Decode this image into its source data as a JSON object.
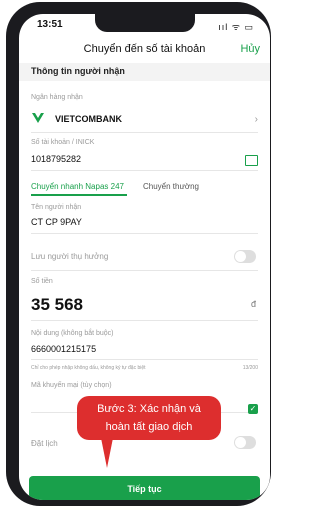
{
  "status": {
    "time": "13:51",
    "icons": "ııl ᯤ ▭"
  },
  "header": {
    "title": "Chuyển đến số tài khoản",
    "cancel": "Hủy"
  },
  "section_title": "Thông tin người nhận",
  "bank": {
    "label": "Ngân hàng nhận",
    "name": "VIETCOMBANK"
  },
  "account": {
    "label": "Số tài khoản / INICK",
    "value": "1018795282"
  },
  "tabs": {
    "active": "Chuyển nhanh Napas 247",
    "inactive": "Chuyển thường"
  },
  "receiver": {
    "label": "Tên người nhận",
    "value": "CT CP 9PAY"
  },
  "save_label": "Lưu người thụ hưởng",
  "amount": {
    "label": "Số tiền",
    "value": "35 568",
    "currency": "đ"
  },
  "content": {
    "label": "Nội dung (không bắt buộc)",
    "value": "6660001215175",
    "hint": "Chỉ cho phép nhập không dấu, không ký tự đặc biệt",
    "counter": "13/200"
  },
  "promo": {
    "label": "Mã khuyến mại (tùy chọn)"
  },
  "schedule_label": "Đặt lịch",
  "callout": {
    "line1": "Bước 3: Xác nhận và",
    "line2": "hoàn tất giao dịch"
  },
  "continue_button": "Tiếp tục",
  "colors": {
    "accent": "#19a04b",
    "callout": "#dd2e2e"
  }
}
